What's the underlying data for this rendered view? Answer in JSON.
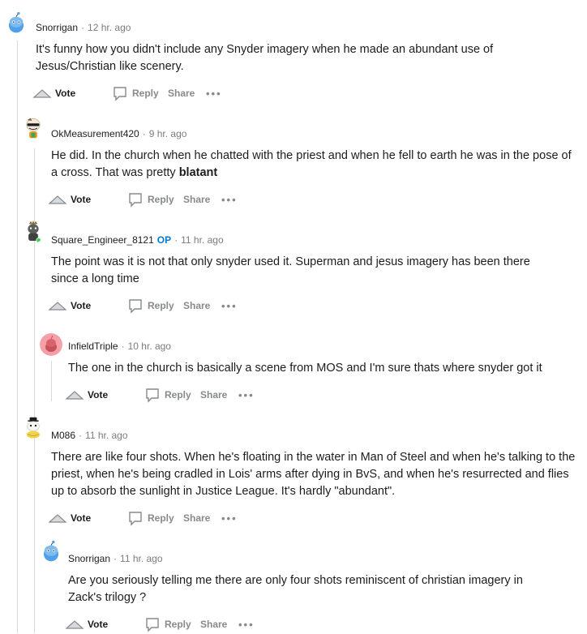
{
  "actions": {
    "vote_label": "Vote",
    "reply_label": "Reply",
    "share_label": "Share",
    "more_label": "•••"
  },
  "comments": [
    {
      "user": "Snorrigan",
      "time": "12 hr. ago",
      "op_badge": "",
      "text": "It's funny how you didn't include any Snyder imagery when he made an abundant use of Jesus/Christian like scenery."
    },
    {
      "user": "OkMeasurement420",
      "time": "9 hr. ago",
      "op_badge": "",
      "text": "He did. In the church when he chatted with the priest and when he fell to earth he was in the pose of a cross. That was pretty ",
      "text_bold": "blatant"
    },
    {
      "user": "Square_Engineer_8121",
      "time": "11 hr. ago",
      "op_badge": "OP",
      "text": "The point was it is not that only snyder used it. Superman and jesus imagery has been there since a long time"
    },
    {
      "user": "InfieldTriple",
      "time": "10 hr. ago",
      "op_badge": "",
      "text": "The one in the church is basically a scene from MOS and I'm sure thats where snyder got it"
    },
    {
      "user": "M086",
      "time": "11 hr. ago",
      "op_badge": "",
      "text": "There are like four shots. When he's floating in the water in Man of Steel and when he's talking to the priest, when he's being cradled in Lois' arms after dying in BvS, and when he's resurrected and flies up to absorb the sunlight in Justice League. It's hardly \"abundant\"."
    },
    {
      "user": "Snorrigan",
      "time": "11 hr. ago",
      "op_badge": "",
      "text": "Are you seriously telling me there are only four shots reminiscent of christian imagery in Zack's trilogy ?"
    }
  ],
  "colors": {
    "thread_line": "#d7dadc",
    "op_blue": "#0079d3",
    "meta_gray": "#7c7c7c",
    "action_gray": "#878a8c"
  }
}
